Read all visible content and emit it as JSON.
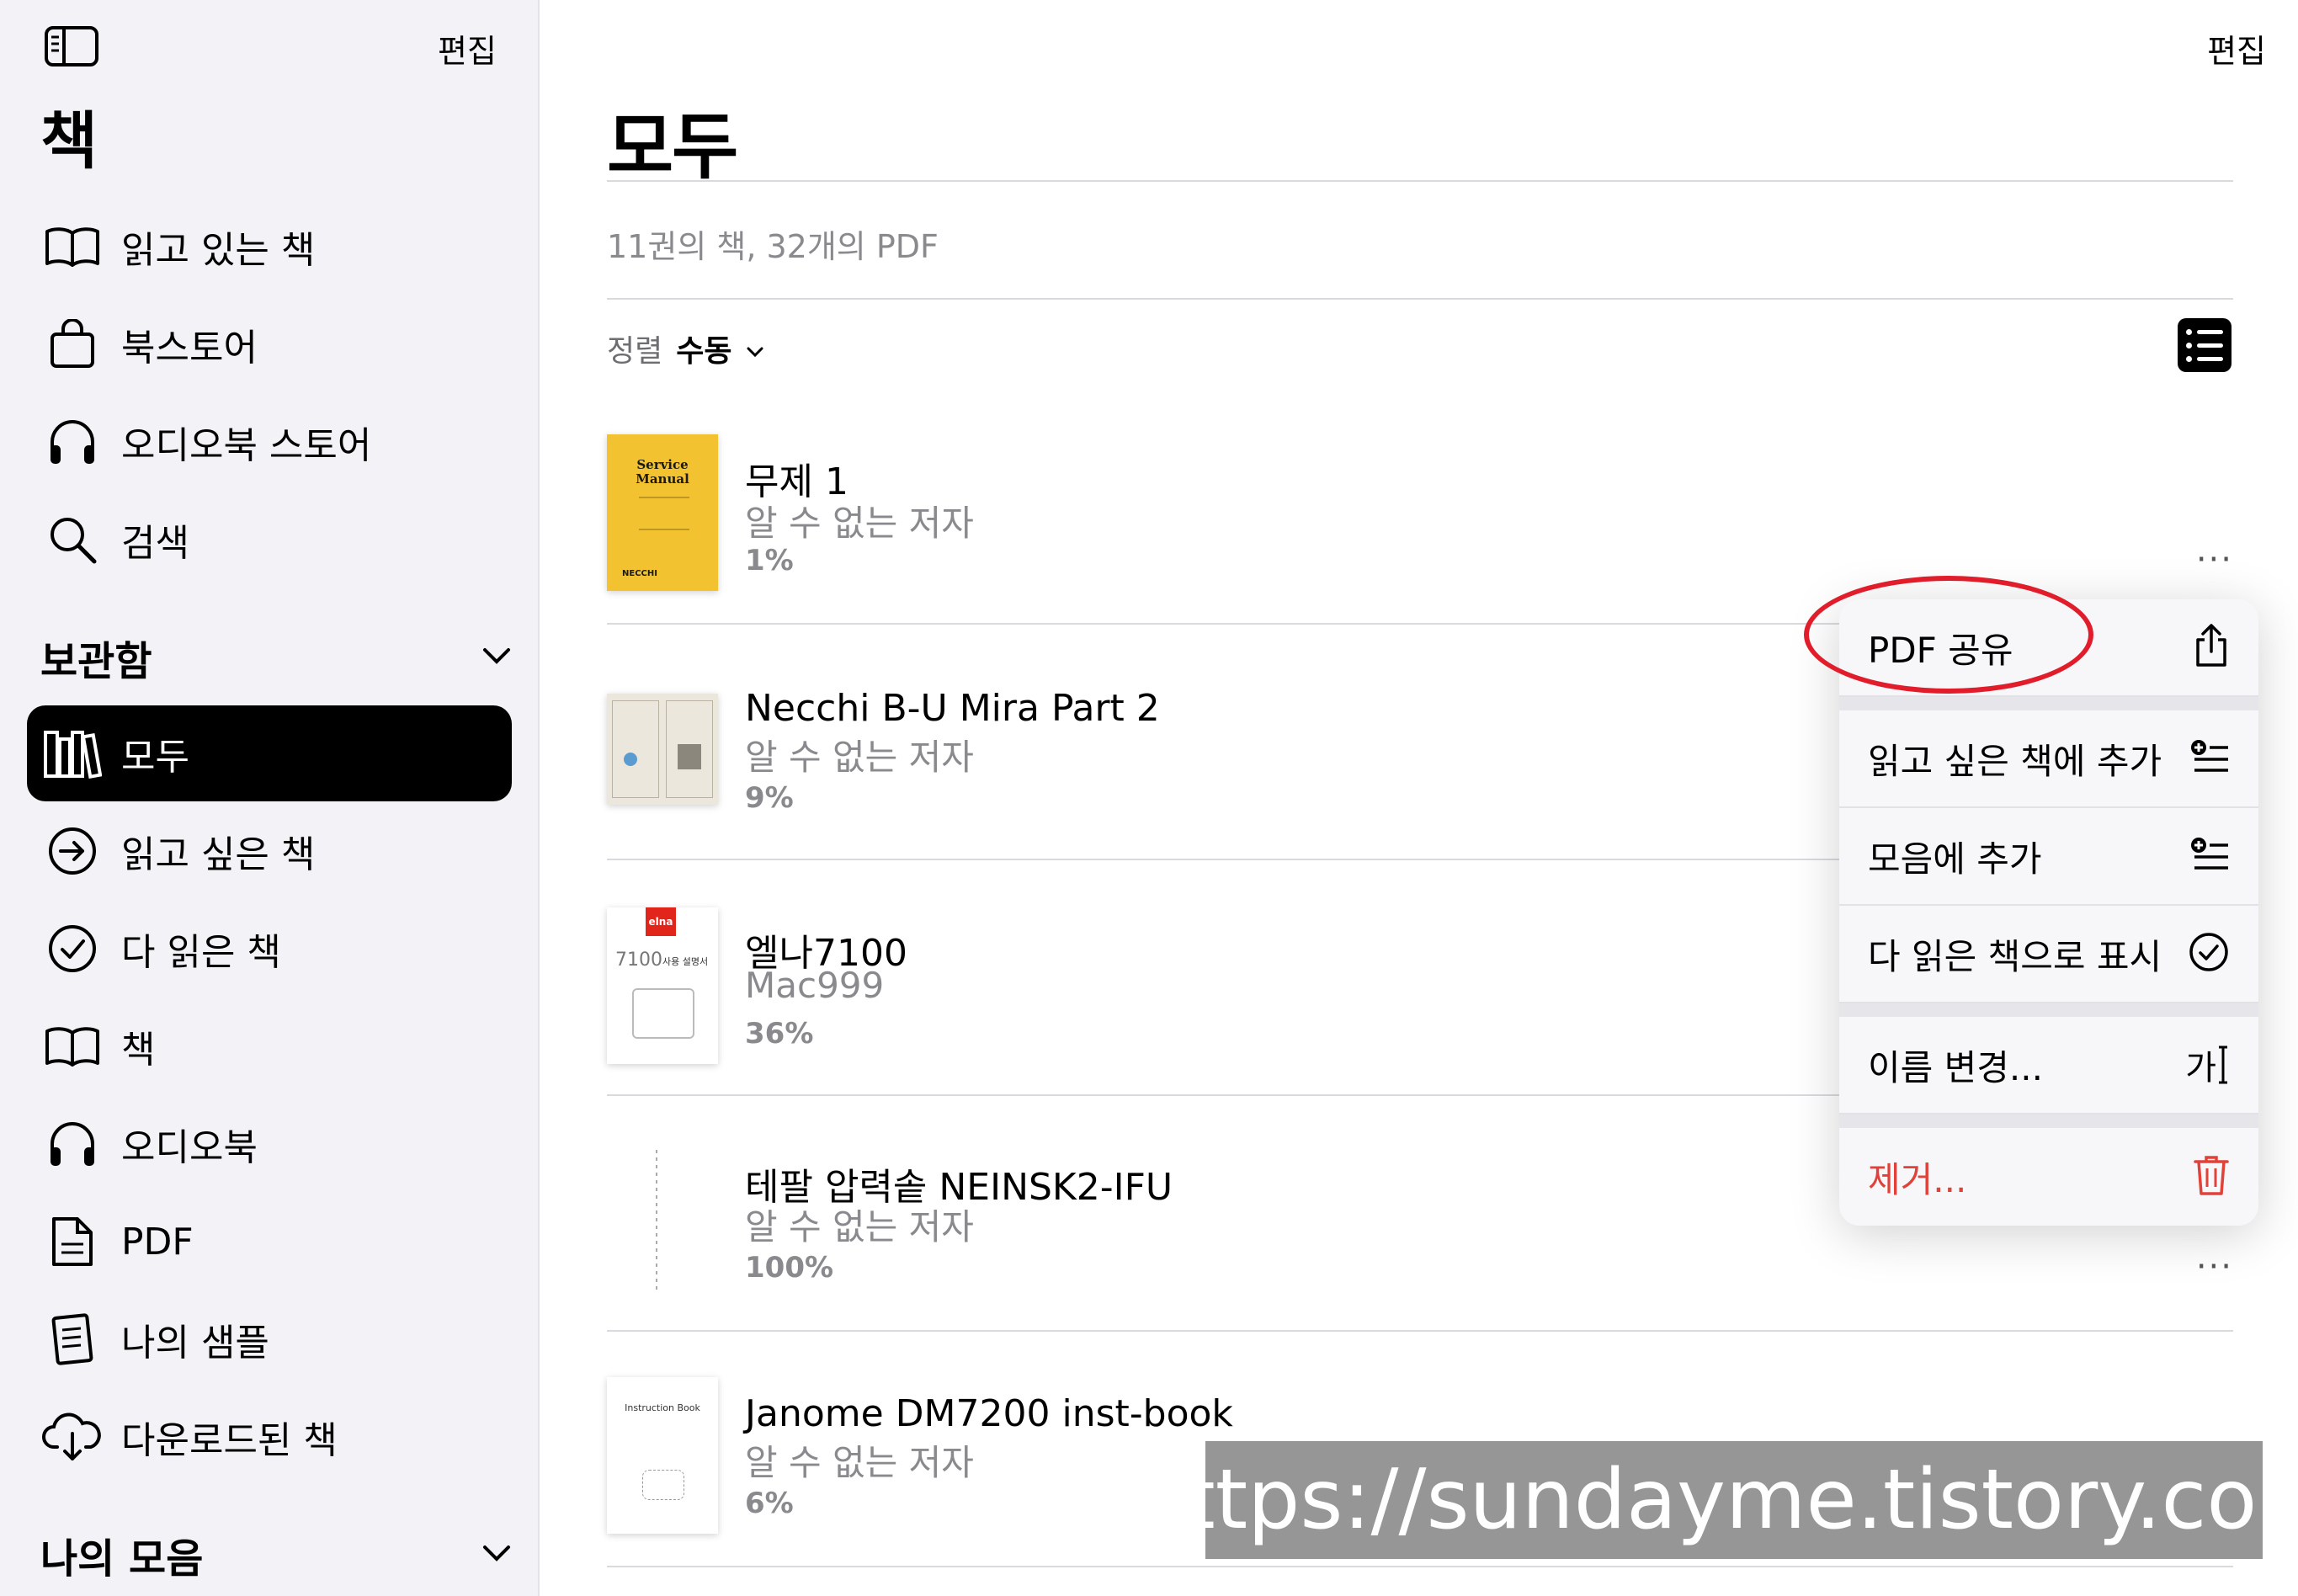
{
  "sidebar": {
    "edit": "편집",
    "title": "책",
    "items": [
      {
        "label": "읽고 있는 책",
        "icon": "book-open-icon"
      },
      {
        "label": "북스토어",
        "icon": "shopping-bag-icon"
      },
      {
        "label": "오디오북 스토어",
        "icon": "headphones-icon"
      },
      {
        "label": "검색",
        "icon": "search-icon"
      }
    ],
    "library_section": "보관함",
    "library": [
      {
        "label": "모두",
        "icon": "books-icon",
        "active": true
      },
      {
        "label": "읽고 싶은 책",
        "icon": "arrow-circle-icon"
      },
      {
        "label": "다 읽은 책",
        "icon": "check-circle-icon"
      },
      {
        "label": "책",
        "icon": "book-open-icon"
      },
      {
        "label": "오디오북",
        "icon": "headphones-icon"
      },
      {
        "label": "PDF",
        "icon": "document-icon"
      },
      {
        "label": "나의 샘플",
        "icon": "sample-icon"
      },
      {
        "label": "다운로드된 책",
        "icon": "cloud-download-icon"
      }
    ],
    "collections_section": "나의 모음"
  },
  "main": {
    "edit": "편집",
    "title": "모두",
    "count": "11권의 책, 32개의 PDF",
    "sort_label": "정렬",
    "sort_value": "수동",
    "books": [
      {
        "title": "무제 1",
        "author": "알 수 없는 저자",
        "progress": "1%"
      },
      {
        "title": "Necchi B-U Mira Part 2",
        "author": "알 수 없는 저자",
        "progress": "9%"
      },
      {
        "title": "엘나7100",
        "author": "Mac999",
        "progress": "36%"
      },
      {
        "title": "테팔 압력솥 NEINSK2-IFU",
        "author": "알 수 없는 저자",
        "progress": "100%"
      },
      {
        "title": "Janome DM7200 inst-book",
        "author": "알 수 없는 저자",
        "progress": "6%"
      }
    ],
    "more": "···",
    "cover1": {
      "line1": "Service",
      "line2": "Manual",
      "brand": "NECCHI"
    },
    "cover3": {
      "brand": "elna",
      "model": "7100",
      "sub": "사용 설명서"
    },
    "cover5": {
      "text": "Instruction Book"
    }
  },
  "menu": {
    "items": [
      {
        "label": "PDF 공유",
        "icon": "share-icon"
      },
      {
        "label": "읽고 싶은 책에 추가",
        "icon": "add-list-icon"
      },
      {
        "label": "모음에 추가",
        "icon": "add-list-icon"
      },
      {
        "label": "다 읽은 책으로 표시",
        "icon": "check-circle-icon"
      },
      {
        "label": "이름 변경...",
        "icon": "rename-icon",
        "icon_text": "가"
      },
      {
        "label": "제거...",
        "icon": "trash-icon"
      }
    ]
  },
  "watermark": "https://sundayme.tistory.com",
  "colors": {
    "accent": "#000000",
    "destructive": "#e0423a",
    "highlight": "#e11d2b"
  }
}
